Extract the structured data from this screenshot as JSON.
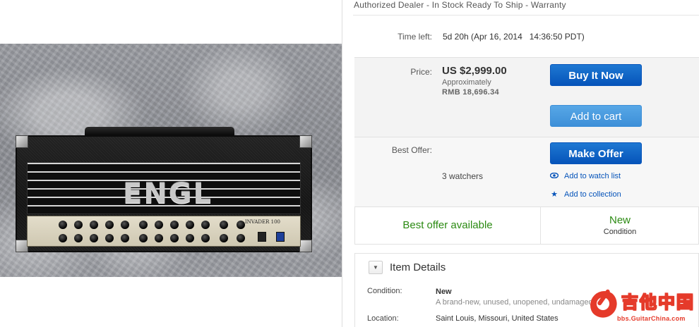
{
  "listing": {
    "dealer_line": "Authorized Dealer - In Stock Ready To Ship - Warranty",
    "time_left_label": "Time left:",
    "time_left_value": "5d 20h (Apr 16, 2014   14:36:50 PDT)",
    "price_label": "Price:",
    "price_value": "US $2,999.00",
    "approx_label": "Approximately",
    "rmb_value": "RMB 18,696.34",
    "buy_now": "Buy It Now",
    "add_to_cart": "Add to cart",
    "best_offer_label": "Best Offer:",
    "make_offer": "Make Offer",
    "watchers": "3 watchers",
    "add_watch": "Add to watch list",
    "add_collection": "Add to collection",
    "best_offer_available": "Best offer available",
    "condition_value": "New",
    "condition_caption": "Condition"
  },
  "item_details": {
    "title": "Item Details",
    "condition_label": "Condition:",
    "condition_value": "New",
    "condition_desc": "A brand-new, unused, unopened, undamaged it",
    "location_label": "Location:",
    "location_value": "Saint Louis, Missouri, United States"
  },
  "product_image": {
    "brand_text": "ENGL",
    "model_text": "INVADER 100"
  },
  "watermark": {
    "chinese": "吉他中国",
    "url": "bbs.GuitarChina.com"
  },
  "icons": {
    "eye": "eye-icon",
    "star": "star-icon",
    "collapse": "collapse-triangle-icon"
  },
  "colors": {
    "primary_button": "#0654ba",
    "secondary_button": "#3d8fd8",
    "green_text": "#2b8a12",
    "link": "#0654ba"
  }
}
